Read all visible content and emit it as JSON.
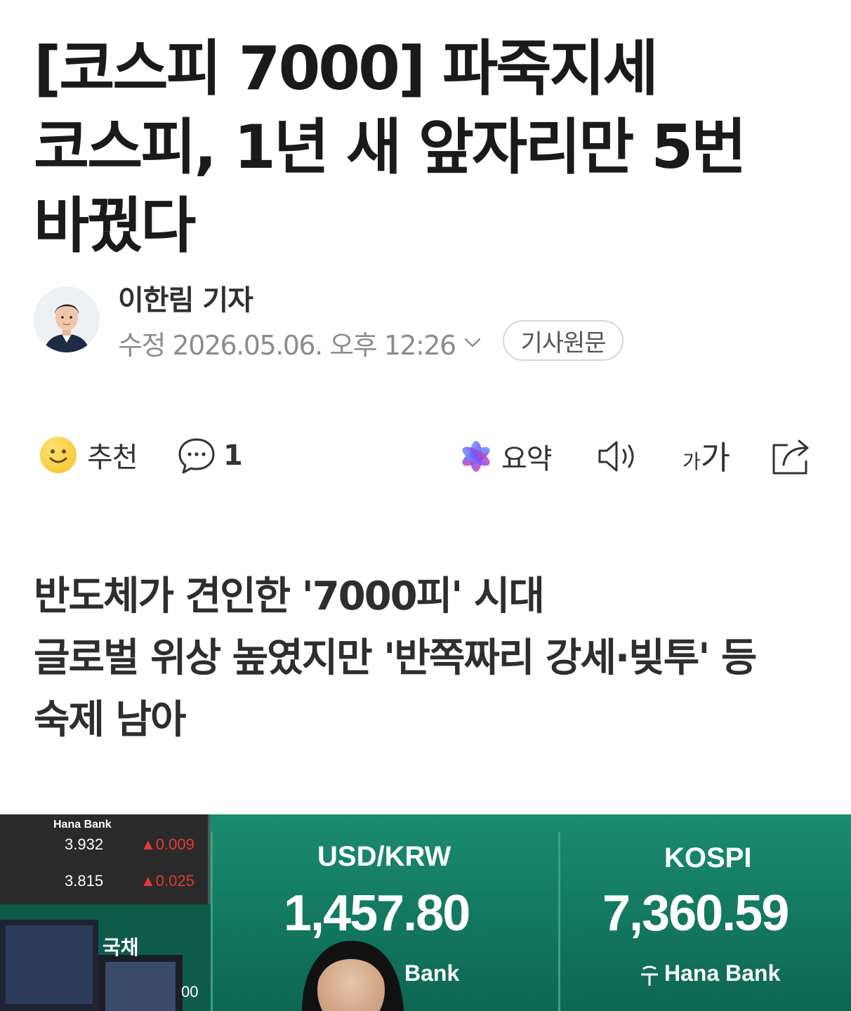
{
  "article": {
    "headline": "[코스피 7000] 파죽지세 코스피, 1년 새 앞자리만 5번 바꿨다",
    "author": {
      "name": "이한림 기자",
      "avatar_icon": "reporter-portrait"
    },
    "date": "수정 2026.05.06. 오후 12:26",
    "original_label": "기사원문",
    "subtitle_lines": [
      "반도체가 견인한 '7000피' 시대",
      "글로벌 위상 높였지만 '반쪽짜리 강세·빚투' 등 숙제 남아"
    ]
  },
  "actions": {
    "recommend": {
      "label": "추천",
      "icon": "smiley-icon"
    },
    "comment": {
      "count": "1",
      "icon": "speech-bubble-icon"
    },
    "summary": {
      "label": "요약",
      "icon": "sparkle-icon"
    },
    "audio": {
      "icon": "speaker-icon"
    },
    "font_size": {
      "small": "가",
      "large": "가",
      "icon": "font-size-icon"
    },
    "share": {
      "icon": "share-icon"
    }
  },
  "photo": {
    "hana_logo_small": "Hana Bank",
    "rows": [
      {
        "value": "3.932",
        "change": "▲0.009"
      },
      {
        "value": "3.815",
        "change": "▲0.025"
      }
    ],
    "bond_label": "국채",
    "usd_krw_label": "USD/KRW",
    "usd_krw_value": "1,457.80",
    "usd_krw_bank": "Bank",
    "kospi_label": "KOSPI",
    "kospi_value": "7,360.59",
    "kospi_bank": "Hana Bank",
    "partial_number": "00",
    "colors": {
      "board_green": "#11725c",
      "up_red": "#e53935"
    }
  }
}
